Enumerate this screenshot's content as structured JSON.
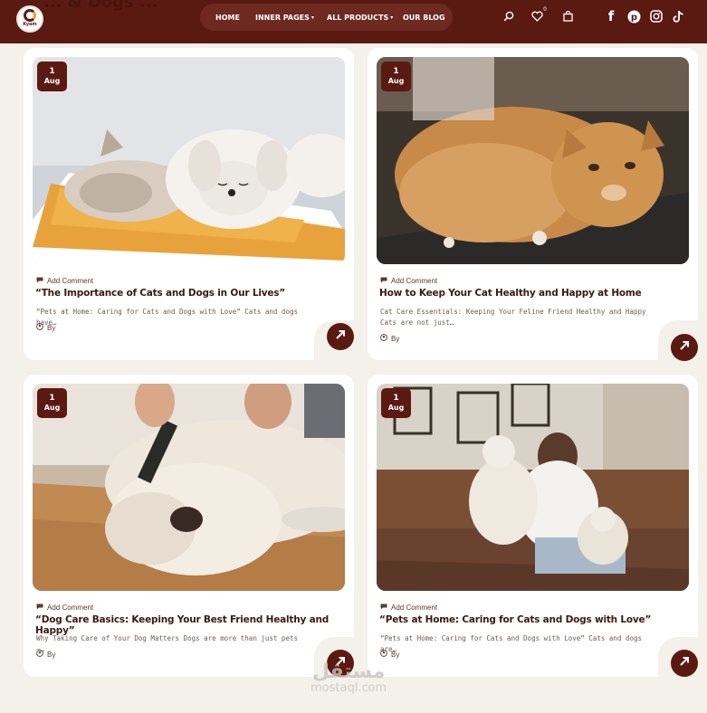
{
  "header": {
    "behind_heading": "... & Dogs ... ",
    "logo_text": "Kyam",
    "nav": [
      {
        "label": "HOME"
      },
      {
        "label": "INNER PAGES"
      },
      {
        "label": "ALL PRODUCTS"
      },
      {
        "label": "OUR BLOG"
      }
    ],
    "icons": [
      "search-icon",
      "heart-icon",
      "bag-icon"
    ],
    "wishlist_count": "0",
    "social": [
      "facebook-icon",
      "pinterest-icon",
      "instagram-icon",
      "tiktok-icon"
    ],
    "colors": {
      "brand": "#5a1a12",
      "page_bg": "#f4f0ea",
      "pill": "#6e2a20"
    }
  },
  "posts": [
    {
      "day": "1",
      "month": "Aug",
      "meta": "Add Comment",
      "title": "“The Importance of Cats and Dogs in Our Lives”",
      "excerpt": "“Pets at Home: Caring for Cats and Dogs with Love” Cats and dogs have…",
      "by": "By",
      "image": "cat-and-puppy-sleeping"
    },
    {
      "day": "1",
      "month": "Aug",
      "meta": "Add Comment",
      "title": "How to Keep Your Cat Healthy and Happy at Home",
      "excerpt": "Cat Care Essentials: Keeping Your Feline Friend Healthy and Happy Cats are not just…",
      "by": "By",
      "image": "ginger-cat-grooming"
    },
    {
      "day": "1",
      "month": "Aug",
      "meta": "Add Comment",
      "title": "“Dog Care Basics: Keeping Your Best Friend Healthy and Happy”",
      "excerpt": "Why Taking Care of Your Dog Matters Dogs are more than just pets –…",
      "by": "By",
      "image": "dog-being-brushed"
    },
    {
      "day": "1",
      "month": "Aug",
      "meta": "Add Comment",
      "title": "“Pets at Home: Caring for Cats and Dogs with Love”",
      "excerpt": "“Pets at Home: Caring for Cats and Dogs with Love” Cats and dogs are…",
      "by": "By",
      "image": "girl-hugging-dogs"
    }
  ],
  "watermark": {
    "arabic": "مستقل",
    "latin": "mostaql.com"
  }
}
